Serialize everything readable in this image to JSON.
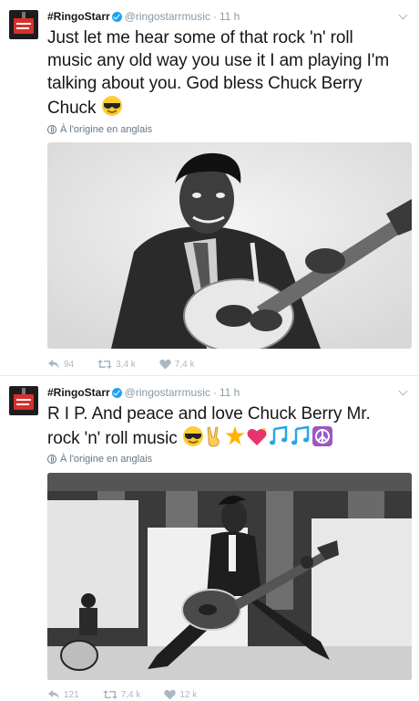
{
  "tweets": [
    {
      "display_name": "#RingoStarr",
      "handle": "@ringostarrmusic",
      "separator": "·",
      "time": "11 h",
      "text_lines": [
        "Just let me hear some of that rock 'n' roll",
        "music any old way you use it I am playing  I'm",
        "talking about you. God bless  Chuck Berry",
        "Chuck"
      ],
      "text_emoji": [
        "smiling-face-with-sunglasses"
      ],
      "translate_label": "À l'origine en anglais",
      "reply_count": "94",
      "retweet_count": "3,4 k",
      "like_count": "7,4 k"
    },
    {
      "display_name": "#RingoStarr",
      "handle": "@ringostarrmusic",
      "separator": "·",
      "time": "11 h",
      "text_lines": [
        "R I P. And peace and love Chuck Berry Mr.",
        "rock 'n' roll music"
      ],
      "text_emoji": [
        "smiling-face-with-sunglasses",
        "victory-hand",
        "glowing-star",
        "sparkling-heart",
        "musical-notes",
        "musical-notes",
        "peace-symbol"
      ],
      "translate_label": "À l'origine en anglais",
      "reply_count": "121",
      "retweet_count": "7,4 k",
      "like_count": "12 k"
    }
  ],
  "colors": {
    "verified": "#1da1f2",
    "meta_gray": "#8899a6",
    "action_gray": "#aab8c2",
    "text": "#14171a"
  }
}
